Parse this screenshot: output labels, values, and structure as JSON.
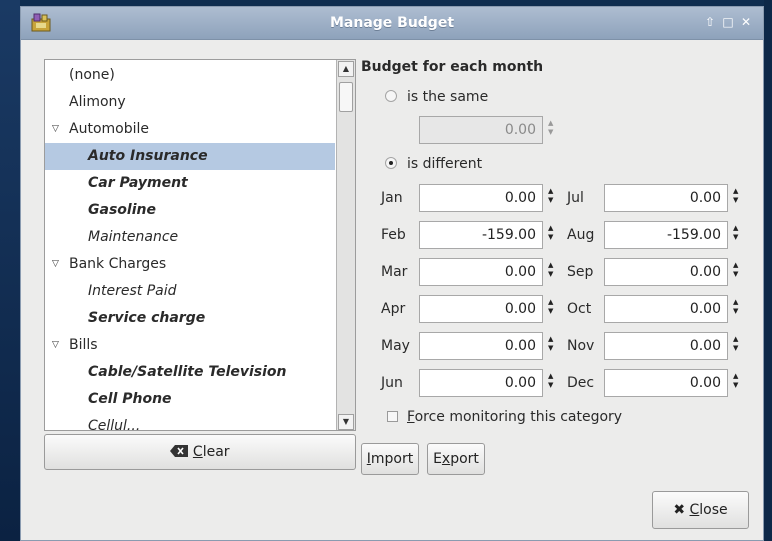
{
  "window": {
    "title": "Manage Budget"
  },
  "tree": [
    {
      "label": "(none)",
      "level": 0,
      "bold": false,
      "italic": false,
      "expanded": null
    },
    {
      "label": "Alimony",
      "level": 0,
      "bold": false,
      "italic": false,
      "expanded": null
    },
    {
      "label": "Automobile",
      "level": 0,
      "bold": false,
      "italic": false,
      "expanded": true
    },
    {
      "label": "Auto Insurance",
      "level": 1,
      "bold": true,
      "italic": true,
      "selected": true
    },
    {
      "label": "Car Payment",
      "level": 1,
      "bold": true,
      "italic": true
    },
    {
      "label": "Gasoline",
      "level": 1,
      "bold": true,
      "italic": true
    },
    {
      "label": "Maintenance",
      "level": 1,
      "bold": false,
      "italic": true
    },
    {
      "label": "Bank Charges",
      "level": 0,
      "bold": false,
      "italic": false,
      "expanded": true
    },
    {
      "label": "Interest Paid",
      "level": 1,
      "bold": false,
      "italic": true
    },
    {
      "label": "Service charge",
      "level": 1,
      "bold": true,
      "italic": true
    },
    {
      "label": "Bills",
      "level": 0,
      "bold": false,
      "italic": false,
      "expanded": true
    },
    {
      "label": "Cable/Satellite Television",
      "level": 1,
      "bold": true,
      "italic": true
    },
    {
      "label": "Cell Phone",
      "level": 1,
      "bold": true,
      "italic": true
    },
    {
      "label": "Cellul...",
      "level": 1,
      "bold": false,
      "italic": true
    }
  ],
  "buttons": {
    "clear_prefix": "",
    "clear_mn": "C",
    "clear_rest": "lear",
    "import_mn": "I",
    "import_rest": "mport",
    "export_pre": "E",
    "export_mn": "x",
    "export_rest": "port",
    "close_mn": "C",
    "close_rest": "lose"
  },
  "budget": {
    "section_title": "Budget for each month",
    "same_label": "is the same",
    "different_label": "is different",
    "same_value": "0.00",
    "mode": "different"
  },
  "months": [
    {
      "name": "Jan",
      "value": "0.00"
    },
    {
      "name": "Feb",
      "value": "-159.00"
    },
    {
      "name": "Mar",
      "value": "0.00"
    },
    {
      "name": "Apr",
      "value": "0.00"
    },
    {
      "name": "May",
      "value": "0.00"
    },
    {
      "name": "Jun",
      "value": "0.00"
    },
    {
      "name": "Jul",
      "value": "0.00"
    },
    {
      "name": "Aug",
      "value": "-159.00"
    },
    {
      "name": "Sep",
      "value": "0.00"
    },
    {
      "name": "Oct",
      "value": "0.00"
    },
    {
      "name": "Nov",
      "value": "0.00"
    },
    {
      "name": "Dec",
      "value": "0.00"
    }
  ],
  "force_monitoring": {
    "mn": "F",
    "rest": "orce monitoring this category",
    "checked": false
  },
  "colors": {
    "titlebar": "#9fb1c8",
    "selection": "#b5c9e2",
    "window_bg": "#ececeb"
  },
  "icons": {
    "app": "budget-puzzle-icon",
    "clear": "backspace-icon",
    "close": "x-icon"
  }
}
